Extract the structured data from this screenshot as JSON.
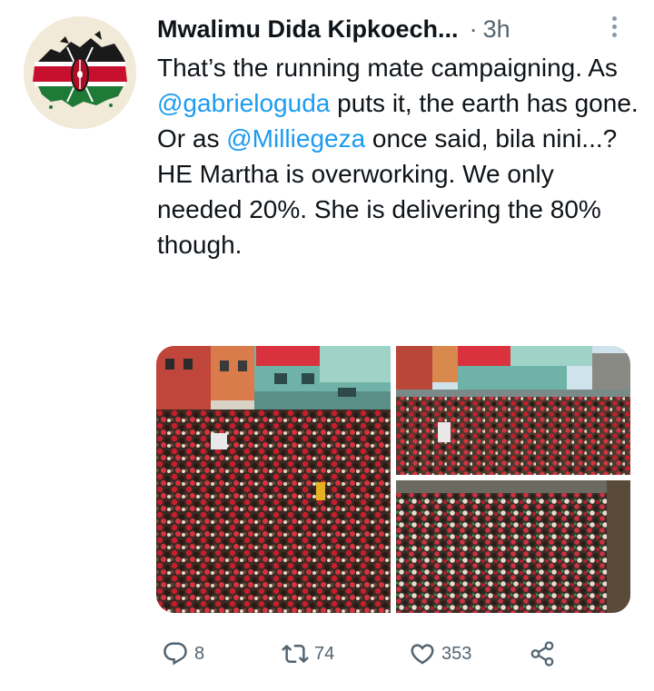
{
  "tweet": {
    "author": "Mwalimu Dida Kipkoech...",
    "separator": "·",
    "time": "3h",
    "text": {
      "line1": "That’s the running mate campaigning. As ",
      "mention1": "@gabrieloguda",
      "line2": " puts it, the earth has gone. Or as ",
      "mention2": "@Milliegeza",
      "line3": " once said, bila nini...? HE Martha is overworking. We only needed 20%. She is delivering the 80% though."
    },
    "media_count": 3
  },
  "actions": {
    "reply_count": "8",
    "retweet_count": "74",
    "like_count": "353"
  },
  "icons": {
    "avatar": "kenya-flag-avatar",
    "more": "more-vertical-icon",
    "reply": "reply-icon",
    "retweet": "retweet-icon",
    "like": "heart-icon",
    "share": "share-icon"
  },
  "colors": {
    "text": "#0f1419",
    "secondary": "#536471",
    "link": "#1d9bf0"
  }
}
